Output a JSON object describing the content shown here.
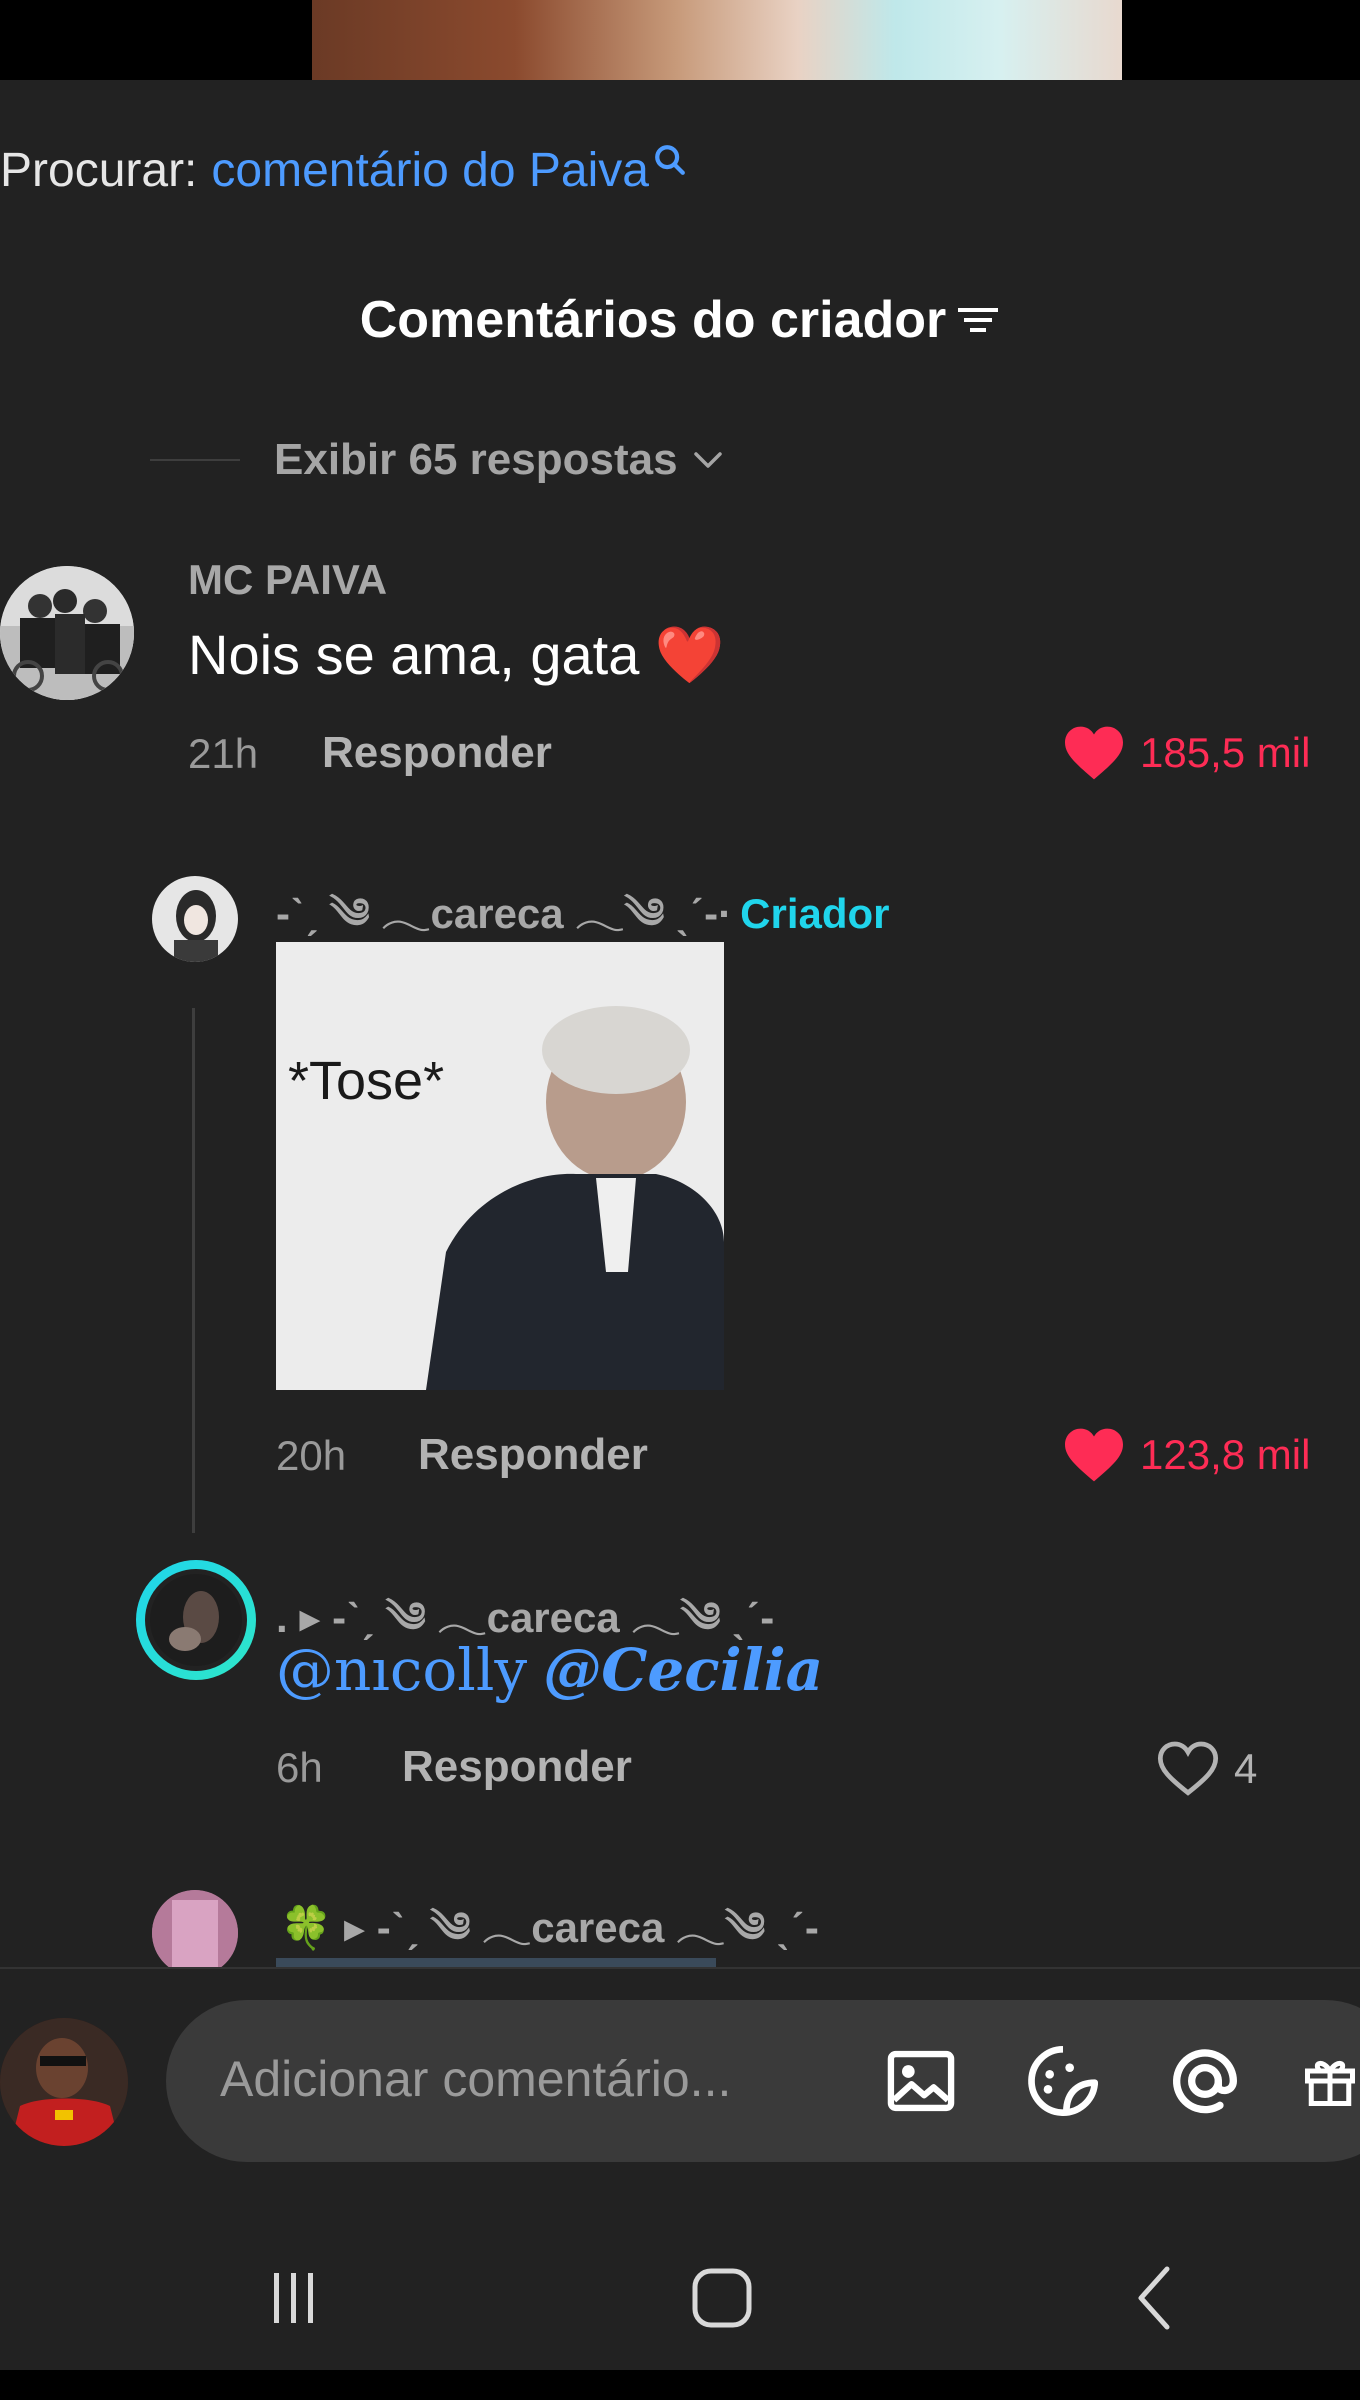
{
  "search": {
    "label": "Procurar:",
    "query": "comentário do Paiva"
  },
  "section": {
    "title": "Comentários do criador"
  },
  "view_replies": "Exibir 65 respostas",
  "comments": [
    {
      "username": "MC PAIVA",
      "text": "Nois se ama, gata ❤️",
      "time": "21h",
      "reply_label": "Responder",
      "likes": "185,5 mil",
      "liked": true
    },
    {
      "username": "-ˋˏ ༄ 𓂃careca 𓂃༄ ˎˊ-·",
      "creator_label": "Criador",
      "sticker_text": "*Tose*",
      "time": "20h",
      "reply_label": "Responder",
      "likes": "123,8 mil",
      "liked": true
    },
    {
      "username": ". ▸ -ˋˏ ༄ 𓂃careca 𓂃༄ ˎˊ-",
      "mention_1": "@nıcolly",
      "mention_2": "@Cecilia",
      "time": "6h",
      "reply_label": "Responder",
      "likes": "4",
      "liked": false
    },
    {
      "username": "🍀 ▸ -ˋˏ ༄ 𓂃careca 𓂃༄ ˎˊ-"
    }
  ],
  "composer": {
    "placeholder": "Adicionar comentário..."
  },
  "icons": [
    "search-icon",
    "filter-icon",
    "chevron-down-icon",
    "heart-icon",
    "image-icon",
    "sticker-icon",
    "mention-icon",
    "gift-icon",
    "recents-icon",
    "home-icon",
    "back-icon"
  ],
  "colors": {
    "background": "#222222",
    "accent_blue": "#4d9bff",
    "creator_cyan": "#20d5ec",
    "like_red": "#fe2c55"
  }
}
